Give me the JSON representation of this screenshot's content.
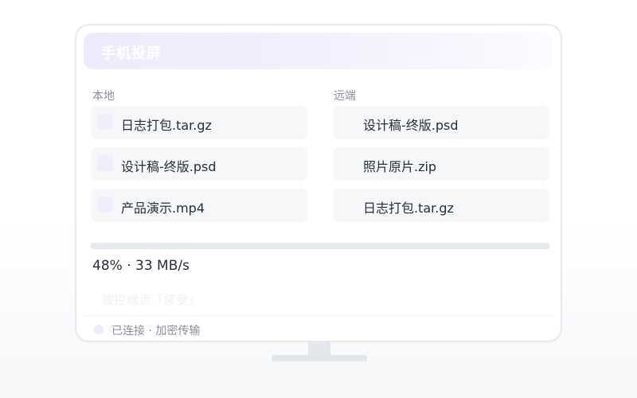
{
  "window": {
    "title": "手机投屏"
  },
  "local": {
    "label": "本地",
    "files": [
      {
        "name": "日志打包.tar.gz"
      },
      {
        "name": "设计稿-终版.psd"
      },
      {
        "name": "产品演示.mp4"
      }
    ]
  },
  "remote": {
    "label": "远端",
    "files": [
      {
        "name": "设计稿-终版.psd"
      },
      {
        "name": "照片原片.zip"
      },
      {
        "name": "日志打包.tar.gz"
      }
    ]
  },
  "transfer": {
    "progress_fraction": 0.48,
    "progress_text": "48% · 33 MB/s"
  },
  "prompt": {
    "text": "被控端点「接受」"
  },
  "status": {
    "text": "已连接 · 加密传输"
  },
  "colors": {
    "accent_soft": "#eeeafc",
    "card_bg": "#f6f7f9",
    "text_primary": "#2a2d35",
    "text_muted": "#8a8e99"
  }
}
